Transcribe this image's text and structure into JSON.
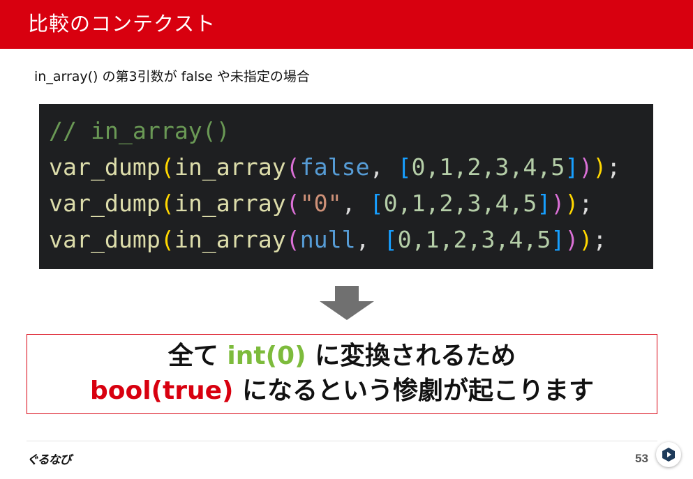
{
  "header": {
    "title": "比較のコンテクスト"
  },
  "subtitle": "in_array() の第3引数が false や未指定の場合",
  "code": {
    "comment": "// in_array()",
    "fn_dump": "var_dump",
    "fn_in_array": "in_array",
    "paren_open": "(",
    "paren_close": ")",
    "line1_arg": "false",
    "line2_arg": "\"0\"",
    "line3_arg": "null",
    "comma_space": ", ",
    "array_open": "[",
    "array_close": "]",
    "array_values": "0,1,2,3,4,5",
    "semicolon": ";"
  },
  "callout": {
    "line1_pre": "全て ",
    "line1_highlight": "int(0)",
    "line1_post": " に変換されるため",
    "line2_highlight": "bool(true)",
    "line2_post": " になるという惨劇が起こります"
  },
  "footer": {
    "logo": "ぐるなび",
    "page_number": "53"
  },
  "colors": {
    "header_red": "#d8000f",
    "code_bg": "#1e1f21",
    "highlight_green": "#7dbb3c",
    "highlight_red": "#d8000f"
  }
}
